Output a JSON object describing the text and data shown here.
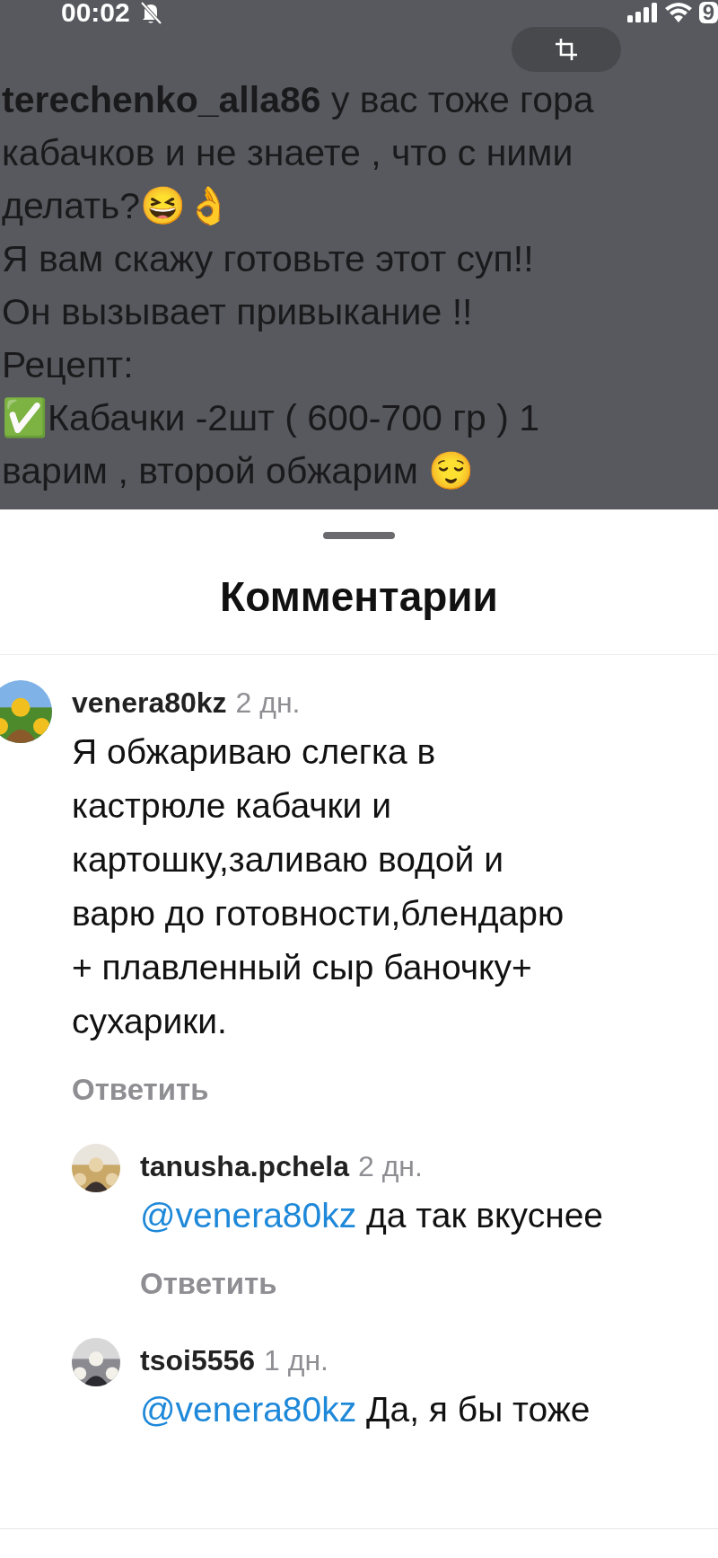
{
  "status_bar": {
    "time": "00:02",
    "silent": true,
    "battery": "9"
  },
  "post": {
    "caption": "**terechenko_alla86** у вас тоже гора\nкабачков и не знаете , что с ними\nделать?😆👌\nЯ вам скажу  готовьте этот суп!!\nОн вызывает привыкание !!\nРецепт:\n✅Кабачки -2шт ( 600-700 гр ) 1\nварим , второй обжарим 😌"
  },
  "sheet": {
    "title": "Комментарии"
  },
  "comments": [
    {
      "username": "venera80kz",
      "time": "2 дн.",
      "text": "Я обжариваю слегка в\nкастрюле кабачки и\nкартошку,заливаю водой и\nварю до готовности,блендарю\n+ плавленный сыр  баночку+\nсухарики.",
      "reply_label": "Ответить",
      "replies": [
        {
          "username": "tanusha.pchela",
          "time": "2 дн.",
          "mention": "@venera80kz",
          "text": "да так вкуснее",
          "reply_label": "Ответить"
        },
        {
          "username": "tsoi5556",
          "time": "1 дн.",
          "mention": "@venera80kz",
          "text": "Да, я бы тоже"
        }
      ]
    }
  ]
}
